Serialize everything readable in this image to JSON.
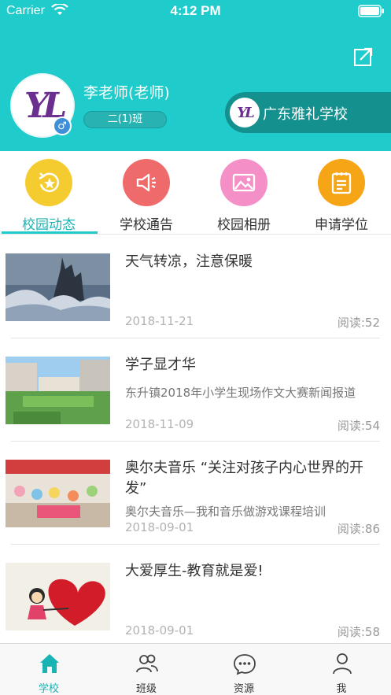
{
  "status_bar": {
    "carrier": "Carrier",
    "time": "4:12 PM"
  },
  "profile": {
    "avatar_text": "YL",
    "gender_symbol": "♂",
    "name": "李老师(老师)",
    "class_label": "二(1)班"
  },
  "school": {
    "logo_text": "YL",
    "name": "广东雅礼学校"
  },
  "categories": [
    {
      "label": "校园动态",
      "icon": "star-refresh-icon",
      "color": "#f5cc2f",
      "active": true
    },
    {
      "label": "学校通告",
      "icon": "megaphone-icon",
      "color": "#ef6b6b",
      "active": false
    },
    {
      "label": "校园相册",
      "icon": "photo-icon",
      "color": "#f48fc8",
      "active": false
    },
    {
      "label": "申请学位",
      "icon": "clipboard-icon",
      "color": "#f5a516",
      "active": false
    }
  ],
  "news": [
    {
      "title": "天气转凉，注意保暖",
      "subtitle": "",
      "date": "2018-11-21",
      "reads": "阅读:52",
      "thumb": "castle-waves-image"
    },
    {
      "title": "学子显才华",
      "subtitle": "东升镇2018年小学生现场作文大赛新闻报道",
      "date": "2018-11-09",
      "reads": "阅读:54",
      "thumb": "school-campus-image"
    },
    {
      "title": "奥尔夫音乐 “关注对孩子内心世界的开发”",
      "subtitle": "奥尔夫音乐—我和音乐做游戏课程培训",
      "date": "2018-09-01",
      "reads": "阅读:86",
      "thumb": "music-class-image"
    },
    {
      "title": "大爱厚生-教育就是爱!",
      "subtitle": "",
      "date": "2018-09-01",
      "reads": "阅读:58",
      "thumb": "heart-girl-image"
    }
  ],
  "bottom_nav": [
    {
      "label": "学校",
      "icon": "home-icon",
      "active": true
    },
    {
      "label": "班级",
      "icon": "group-icon",
      "active": false
    },
    {
      "label": "资源",
      "icon": "chat-bubble-icon",
      "active": false
    },
    {
      "label": "我",
      "icon": "person-icon",
      "active": false
    }
  ],
  "colors": {
    "brand_teal": "#1fcbcb",
    "school_pill": "#14908f",
    "active_text": "#1ab3b3"
  }
}
